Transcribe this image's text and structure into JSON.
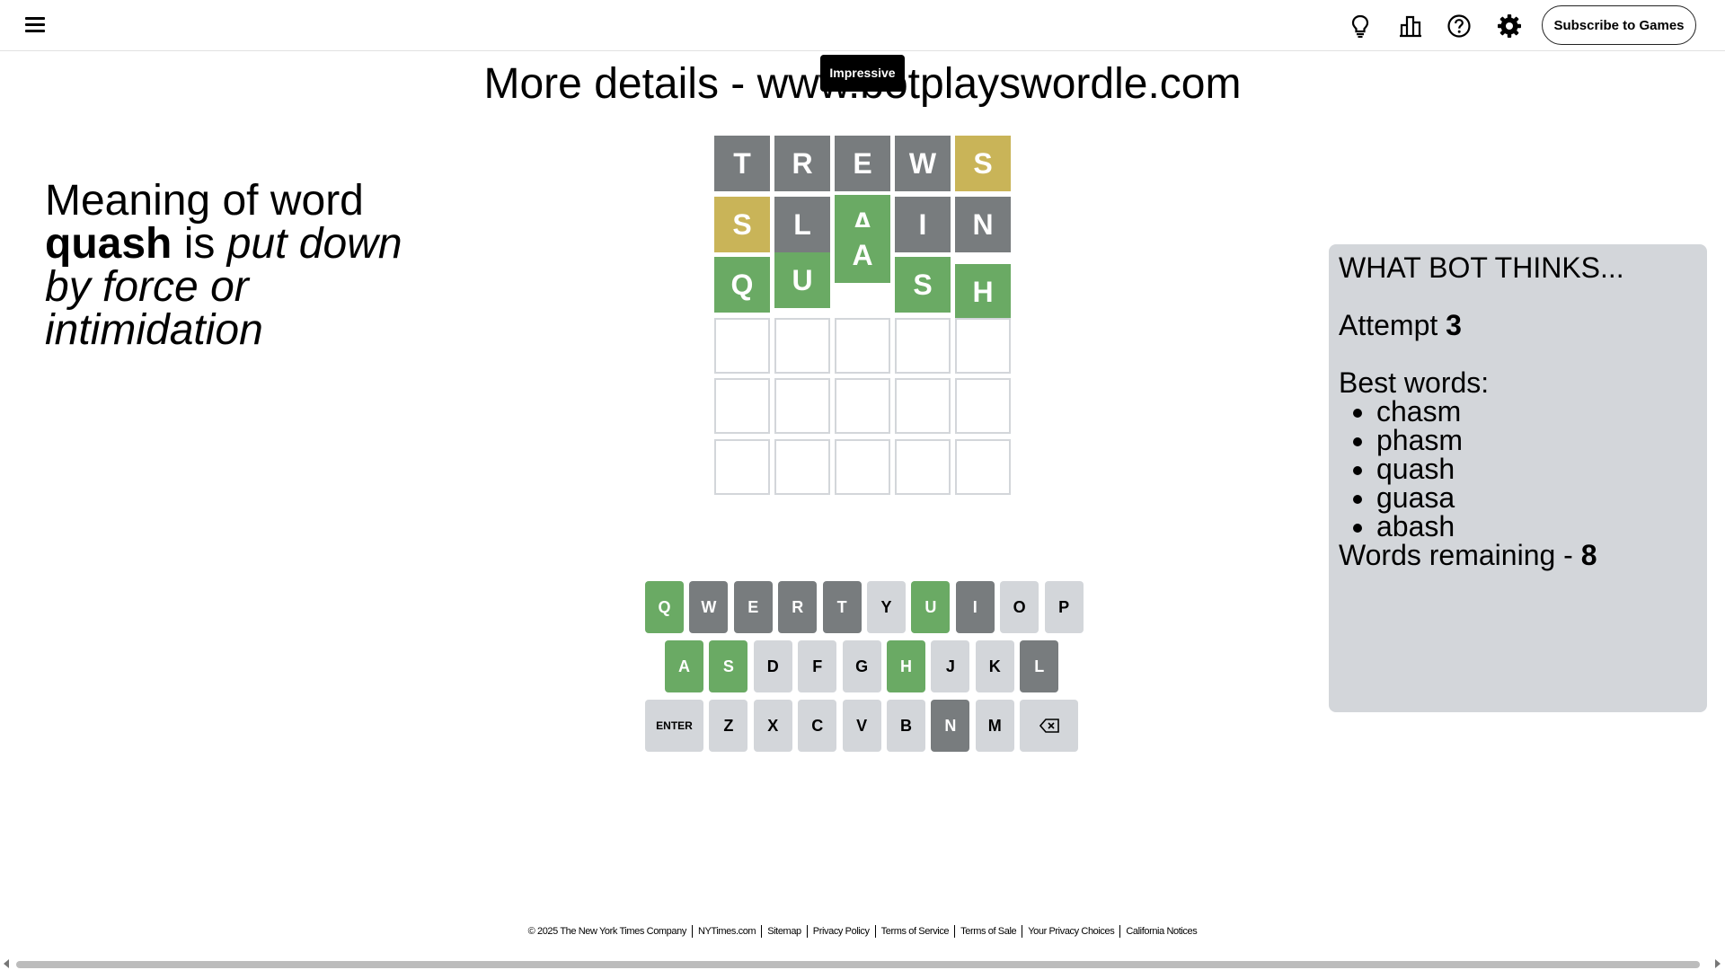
{
  "header": {
    "menu_icon": "hamburger-menu-icon",
    "icons": [
      "lightbulb-icon",
      "statistics-icon",
      "help-icon",
      "gear-icon"
    ],
    "subscribe_label": "Subscribe to Games"
  },
  "headline": "More details - www.botplayswordle.com",
  "toast": "Impressive",
  "meaning": {
    "prefix": "Meaning of word",
    "word": "quash",
    "is": "is",
    "definition": "put down by force or intimidation"
  },
  "board": {
    "rows": [
      [
        {
          "letter": "T",
          "state": "absent"
        },
        {
          "letter": "R",
          "state": "absent"
        },
        {
          "letter": "E",
          "state": "absent"
        },
        {
          "letter": "W",
          "state": "absent"
        },
        {
          "letter": "S",
          "state": "present"
        }
      ],
      [
        {
          "letter": "S",
          "state": "present"
        },
        {
          "letter": "L",
          "state": "absent"
        },
        {
          "letter": "A",
          "state": "correct"
        },
        {
          "letter": "I",
          "state": "absent"
        },
        {
          "letter": "N",
          "state": "absent"
        }
      ],
      [
        {
          "letter": "Q",
          "state": "correct"
        },
        {
          "letter": "U",
          "state": "correct"
        },
        {
          "letter": "A",
          "state": "correct"
        },
        {
          "letter": "S",
          "state": "correct"
        },
        {
          "letter": "H",
          "state": "correct"
        }
      ],
      [
        {
          "letter": "",
          "state": "empty"
        },
        {
          "letter": "",
          "state": "empty"
        },
        {
          "letter": "",
          "state": "empty"
        },
        {
          "letter": "",
          "state": "empty"
        },
        {
          "letter": "",
          "state": "empty"
        }
      ],
      [
        {
          "letter": "",
          "state": "empty"
        },
        {
          "letter": "",
          "state": "empty"
        },
        {
          "letter": "",
          "state": "empty"
        },
        {
          "letter": "",
          "state": "empty"
        },
        {
          "letter": "",
          "state": "empty"
        }
      ],
      [
        {
          "letter": "",
          "state": "empty"
        },
        {
          "letter": "",
          "state": "empty"
        },
        {
          "letter": "",
          "state": "empty"
        },
        {
          "letter": "",
          "state": "empty"
        },
        {
          "letter": "",
          "state": "empty"
        }
      ]
    ]
  },
  "keyboard": {
    "rows": [
      [
        {
          "label": "Q",
          "state": "correct"
        },
        {
          "label": "W",
          "state": "absent"
        },
        {
          "label": "E",
          "state": "absent"
        },
        {
          "label": "R",
          "state": "absent"
        },
        {
          "label": "T",
          "state": "absent"
        },
        {
          "label": "Y",
          "state": "unused"
        },
        {
          "label": "U",
          "state": "correct"
        },
        {
          "label": "I",
          "state": "absent"
        },
        {
          "label": "O",
          "state": "unused"
        },
        {
          "label": "P",
          "state": "unused"
        }
      ],
      [
        {
          "label": "A",
          "state": "correct"
        },
        {
          "label": "S",
          "state": "correct"
        },
        {
          "label": "D",
          "state": "unused"
        },
        {
          "label": "F",
          "state": "unused"
        },
        {
          "label": "G",
          "state": "unused"
        },
        {
          "label": "H",
          "state": "correct"
        },
        {
          "label": "J",
          "state": "unused"
        },
        {
          "label": "K",
          "state": "unused"
        },
        {
          "label": "L",
          "state": "absent"
        }
      ],
      [
        {
          "label": "ENTER",
          "state": "unused"
        },
        {
          "label": "Z",
          "state": "unused"
        },
        {
          "label": "X",
          "state": "unused"
        },
        {
          "label": "C",
          "state": "unused"
        },
        {
          "label": "V",
          "state": "unused"
        },
        {
          "label": "B",
          "state": "unused"
        },
        {
          "label": "N",
          "state": "absent"
        },
        {
          "label": "M",
          "state": "unused"
        },
        {
          "label": "",
          "state": "unused",
          "icon": "backspace-icon"
        }
      ]
    ]
  },
  "bot_panel": {
    "title": "WHAT BOT THINKS...",
    "attempt_label": "Attempt",
    "attempt_value": "3",
    "best_words_label": "Best words:",
    "best_words": [
      "chasm",
      "phasm",
      "quash",
      "guasa",
      "abash"
    ],
    "remaining_label": "Words remaining -",
    "remaining_value": "8"
  },
  "footer": {
    "links": [
      "© 2025 The New York Times Company",
      "NYTimes.com",
      "Sitemap",
      "Privacy Policy",
      "Terms of Service",
      "Terms of Sale",
      "Your Privacy Choices",
      "California Notices"
    ]
  },
  "colors": {
    "correct": "#6aaa64",
    "present": "#c9b458",
    "absent": "#787c7e",
    "unused": "#d3d6da",
    "panel": "#d3d6da"
  }
}
